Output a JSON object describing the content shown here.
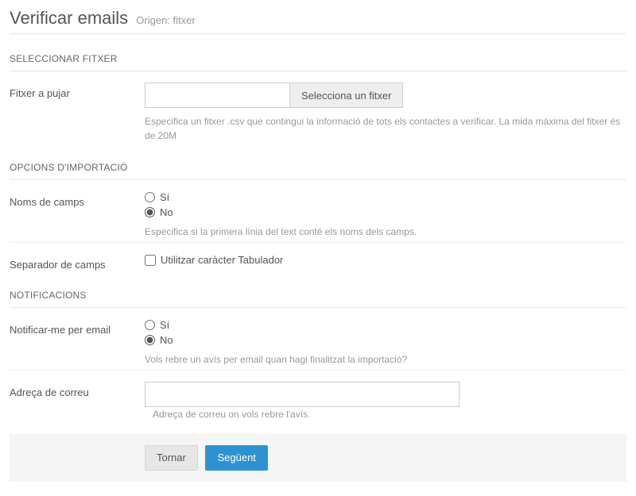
{
  "page": {
    "title": "Verificar emails",
    "subtitle": "Origen: fitxer"
  },
  "sections": {
    "select_file": {
      "header": "SELECCIONAR FITXER",
      "upload_label": "Fitxer a pujar",
      "upload_value": "",
      "select_button": "Selecciona un fitxer",
      "help": "Especifica un fitxer .csv que contingui la informació de tots els contactes a verificar. La mida màxima del fitxer és de 20M"
    },
    "import_options": {
      "header": "OPCIONS D'IMPORTACIÓ",
      "field_names_label": "Noms de camps",
      "option_yes": "Sí",
      "option_no": "No",
      "field_names_help": "Especifica si la primera línia del text conté els noms dels camps.",
      "separator_label": "Separador de camps",
      "separator_checkbox": "Utilitzar caràcter Tabulador"
    },
    "notifications": {
      "header": "NOTIFICACIONS",
      "notify_label": "Notificar-me per email",
      "option_yes": "Sí",
      "option_no": "No",
      "notify_help": "Vols rebre un avís per email quan hagi finalitzat la importació?",
      "email_label": "Adreça de correu",
      "email_value": "",
      "email_help": "Adreça de correu on vols rebre l'avís."
    }
  },
  "footer": {
    "back": "Tornar",
    "next": "Següent"
  }
}
